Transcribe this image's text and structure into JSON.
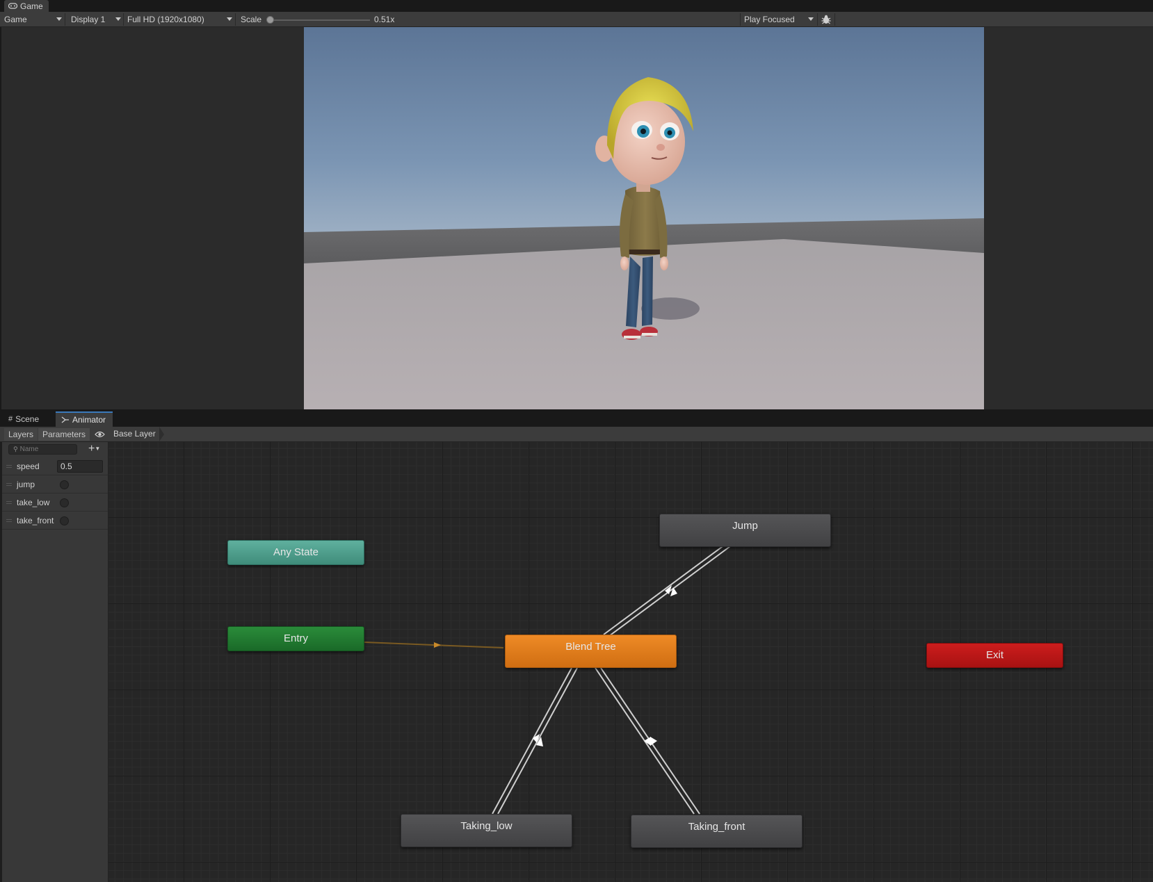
{
  "game": {
    "tab_label": "Game",
    "toolbar": {
      "view_mode": "Game",
      "display": "Display 1",
      "resolution": "Full HD (1920x1080)",
      "scale_label": "Scale",
      "scale_value": "0.51x",
      "scale_fraction": 0.0,
      "play_mode": "Play Focused"
    }
  },
  "animator": {
    "tabs": [
      {
        "label": "Scene",
        "icon": "grid-icon",
        "active": false
      },
      {
        "label": "Animator",
        "icon": "animator-icon",
        "active": true
      }
    ],
    "header": {
      "layers_label": "Layers",
      "parameters_label": "Parameters",
      "breadcrumb": "Base Layer"
    },
    "search_placeholder": "Name",
    "parameters": [
      {
        "name": "speed",
        "type": "float",
        "value": "0.5"
      },
      {
        "name": "jump",
        "type": "trigger",
        "value": ""
      },
      {
        "name": "take_low",
        "type": "trigger",
        "value": ""
      },
      {
        "name": "take_front",
        "type": "trigger",
        "value": ""
      }
    ],
    "states": {
      "any_state": "Any State",
      "entry": "Entry",
      "blend_tree": "Blend Tree",
      "jump": "Jump",
      "exit": "Exit",
      "taking_low": "Taking_low",
      "taking_front": "Taking_front"
    },
    "colors": {
      "any_state": "#4f9e8c",
      "entry": "#1f7a2e",
      "default_state": "#e0791b",
      "state": "#4a4a4c",
      "exit": "#b81818"
    }
  }
}
